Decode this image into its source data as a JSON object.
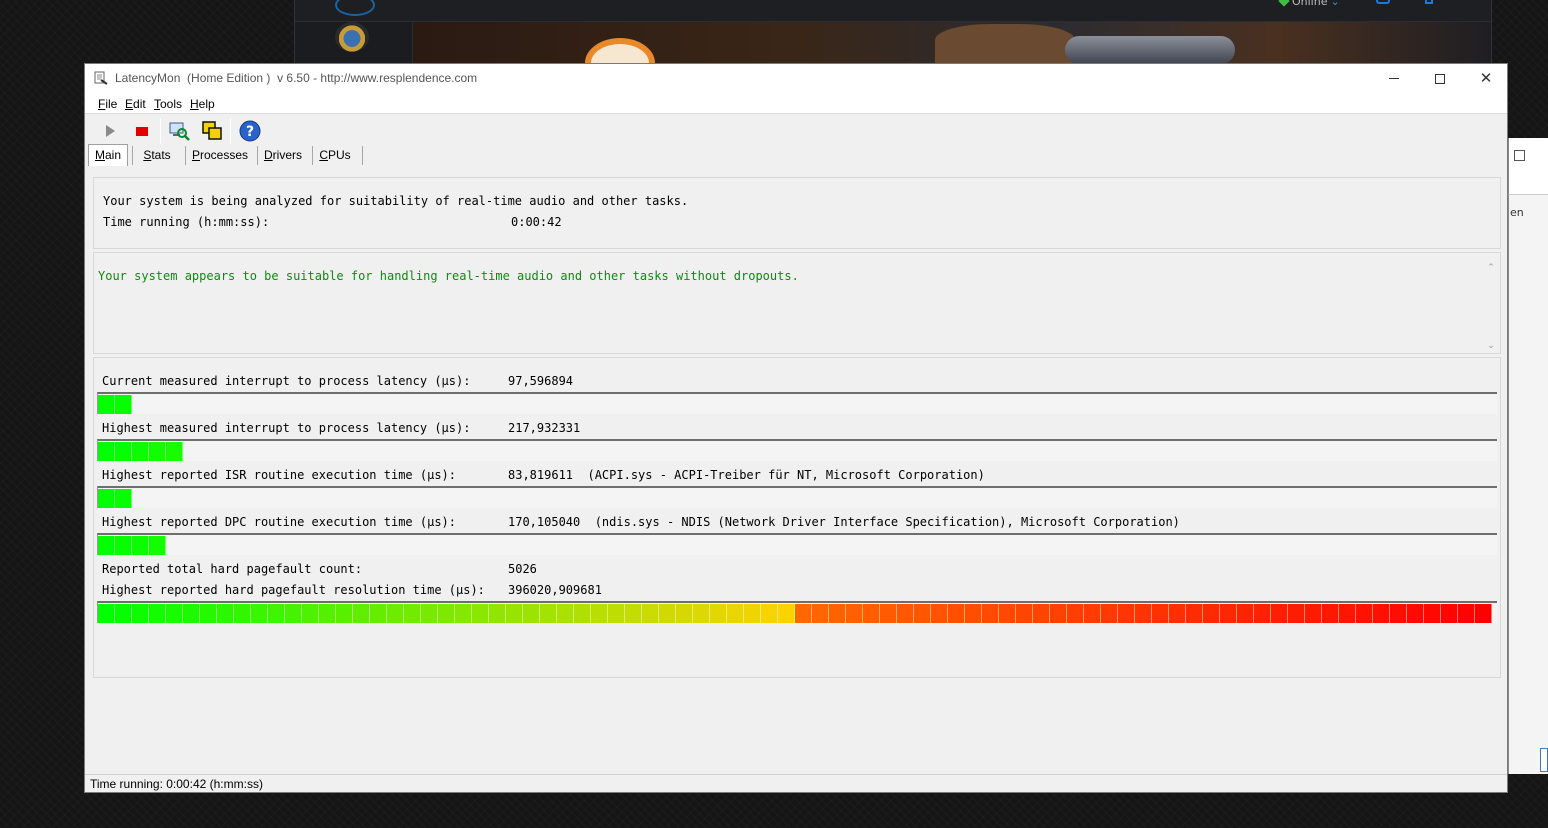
{
  "background": {
    "battlenet_status": "Online"
  },
  "window": {
    "title": "LatencyMon  (Home Edition )  v 6.50 - http://www.resplendence.com",
    "min_icon": "minimize-icon",
    "max_icon": "maximize-icon",
    "close_icon": "close-icon"
  },
  "menu": [
    {
      "acc": "F",
      "rest": "ile"
    },
    {
      "acc": "E",
      "rest": "dit"
    },
    {
      "acc": "T",
      "rest": "ools"
    },
    {
      "acc": "H",
      "rest": "elp"
    }
  ],
  "toolbar": {
    "start_icon": "play-icon",
    "stop_icon": "stop-icon",
    "driver_icon": "computer-search-icon",
    "windows_icon": "windows-icon",
    "help_icon": "help-icon"
  },
  "tabs": [
    {
      "acc": "M",
      "rest": "ain"
    },
    {
      "acc": "S",
      "rest": "tats"
    },
    {
      "acc": "P",
      "rest": "rocesses"
    },
    {
      "acc": "D",
      "rest": "rivers"
    },
    {
      "acc": "C",
      "rest": "PUs"
    }
  ],
  "status": {
    "line1": "Your system is being analyzed for suitability of real-time audio and other tasks.",
    "time_label": "Time running (h:mm:ss):",
    "time_value": "0:00:42"
  },
  "verdict": {
    "text": "Your system appears to be suitable for handling real-time audio and other tasks without dropouts.",
    "color": "#0f8a0f"
  },
  "meters": [
    {
      "label": "Current measured interrupt to process latency (µs):",
      "value": "97,596894",
      "detail": "",
      "bar_fraction": 0.024
    },
    {
      "label": "Highest measured interrupt to process latency (µs):",
      "value": "217,932331",
      "detail": "",
      "bar_fraction": 0.06
    },
    {
      "label": "Highest reported ISR routine execution time (µs):",
      "value": "83,819611",
      "detail": "(ACPI.sys - ACPI-Treiber für NT, Microsoft Corporation)",
      "bar_fraction": 0.024
    },
    {
      "label": "Highest reported DPC routine execution time (µs):",
      "value": "170,105040",
      "detail": "(ndis.sys - NDIS (Network Driver Interface Specification), Microsoft Corporation)",
      "bar_fraction": 0.048
    }
  ],
  "pagefault": {
    "count_label": "Reported total hard pagefault count:",
    "count_value": "5026",
    "time_label": "Highest reported hard pagefault resolution time (µs):",
    "time_value": "396020,909681",
    "bar_fraction": 1.0
  },
  "statusbar": {
    "text": "Time running: 0:00:42  (h:mm:ss)"
  }
}
